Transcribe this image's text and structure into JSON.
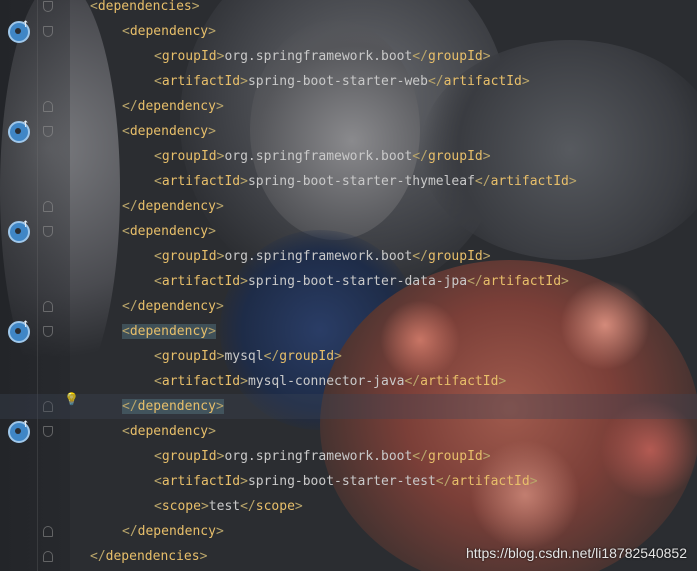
{
  "colors": {
    "tag": "#e8bf6a",
    "text": "#c9c9c9",
    "background": "#2b2d31",
    "run_icon": "#3f86c6"
  },
  "lines": [
    {
      "indent": 1,
      "kind": "open",
      "tag": "dependencies"
    },
    {
      "indent": 2,
      "kind": "open",
      "tag": "dependency"
    },
    {
      "indent": 3,
      "kind": "elem",
      "tag": "groupId",
      "value": "org.springframework.boot"
    },
    {
      "indent": 3,
      "kind": "elem",
      "tag": "artifactId",
      "value": "spring-boot-starter-web"
    },
    {
      "indent": 2,
      "kind": "close",
      "tag": "dependency"
    },
    {
      "indent": 2,
      "kind": "open",
      "tag": "dependency"
    },
    {
      "indent": 3,
      "kind": "elem",
      "tag": "groupId",
      "value": "org.springframework.boot"
    },
    {
      "indent": 3,
      "kind": "elem",
      "tag": "artifactId",
      "value": "spring-boot-starter-thymeleaf"
    },
    {
      "indent": 2,
      "kind": "close",
      "tag": "dependency"
    },
    {
      "indent": 2,
      "kind": "open",
      "tag": "dependency"
    },
    {
      "indent": 3,
      "kind": "elem",
      "tag": "groupId",
      "value": "org.springframework.boot"
    },
    {
      "indent": 3,
      "kind": "elem",
      "tag": "artifactId",
      "value": "spring-boot-starter-data-jpa"
    },
    {
      "indent": 2,
      "kind": "close",
      "tag": "dependency"
    },
    {
      "indent": 2,
      "kind": "open",
      "tag": "dependency",
      "match": true
    },
    {
      "indent": 3,
      "kind": "elem",
      "tag": "groupId",
      "value": "mysql"
    },
    {
      "indent": 3,
      "kind": "elem",
      "tag": "artifactId",
      "value": "mysql-connector-java"
    },
    {
      "indent": 2,
      "kind": "close",
      "tag": "dependency",
      "match": true,
      "highlight": true
    },
    {
      "indent": 2,
      "kind": "open",
      "tag": "dependency"
    },
    {
      "indent": 3,
      "kind": "elem",
      "tag": "groupId",
      "value": "org.springframework.boot"
    },
    {
      "indent": 3,
      "kind": "elem",
      "tag": "artifactId",
      "value": "spring-boot-starter-test"
    },
    {
      "indent": 3,
      "kind": "elem",
      "tag": "scope",
      "value": "test"
    },
    {
      "indent": 2,
      "kind": "close",
      "tag": "dependency"
    },
    {
      "indent": 1,
      "kind": "close",
      "tag": "dependencies"
    }
  ],
  "run_icon_lines": [
    1,
    5,
    9,
    13,
    17
  ],
  "watermark": "https://blog.csdn.net/li18782540852"
}
